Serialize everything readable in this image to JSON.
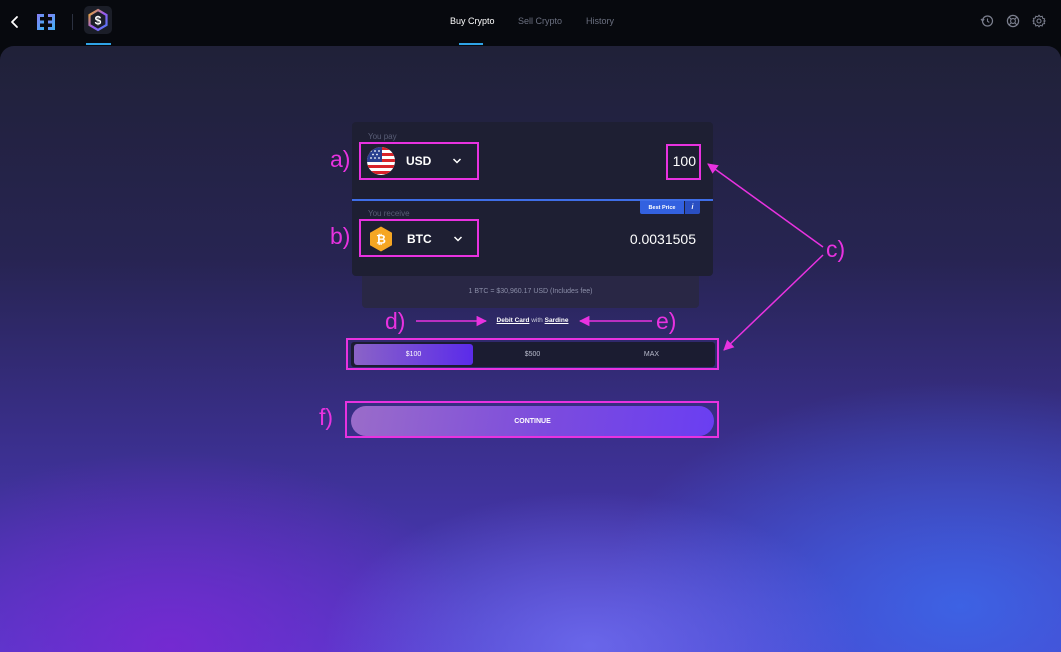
{
  "topbar": {
    "tabs": [
      {
        "label": "Buy Crypto",
        "active": true
      },
      {
        "label": "Sell Crypto",
        "active": false
      },
      {
        "label": "History",
        "active": false
      }
    ],
    "right_icons": [
      "history-icon",
      "support-icon",
      "settings-icon"
    ]
  },
  "pay": {
    "label": "You pay",
    "currency": "USD",
    "amount": "100"
  },
  "receive": {
    "label": "You receive",
    "currency": "BTC",
    "amount": "0.0031505",
    "badge": "Best Price",
    "info": "i"
  },
  "rate_text": "1 BTC = $30,960.17 USD (Includes fee)",
  "method": {
    "payment": "Debit Card",
    "with": "with",
    "provider": "Sardine"
  },
  "amount_options": [
    {
      "label": "$100",
      "active": true
    },
    {
      "label": "$500",
      "active": false
    },
    {
      "label": "MAX",
      "active": false
    }
  ],
  "continue_label": "CONTINUE",
  "annotations": {
    "a": "a)",
    "b": "b)",
    "c": "c)",
    "d": "d)",
    "e": "e)",
    "f": "f)",
    "color": "#e832e0"
  },
  "colors": {
    "accent_blue": "#3f6ee8",
    "tab_underline": "#2fa3e6",
    "card_bg": "#1e1f33"
  }
}
